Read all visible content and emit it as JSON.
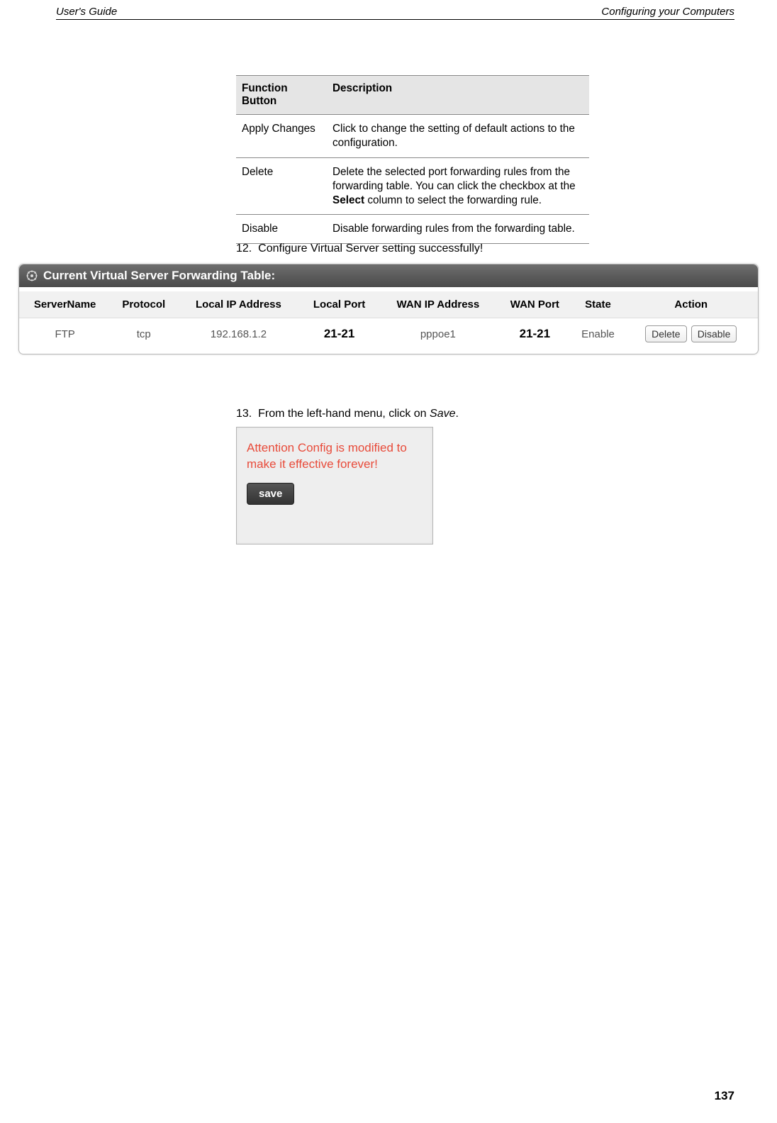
{
  "header": {
    "left": "User's Guide",
    "right": "Configuring your Computers"
  },
  "funcTable": {
    "headers": [
      "Function Button",
      "Description"
    ],
    "rows": [
      {
        "btn": "Apply Changes",
        "desc": "Click to change the setting of default actions to the configuration."
      },
      {
        "btn": "Delete",
        "desc_pre": "Delete the selected port forwarding rules from the forwarding table. You can click the checkbox at the ",
        "desc_bold": "Select",
        "desc_post": " column to select the forwarding rule."
      },
      {
        "btn": "Disable",
        "desc": "Disable forwarding rules from the forwarding table."
      }
    ]
  },
  "step12": {
    "num": "12.",
    "text": "Configure Virtual Server setting successfully!"
  },
  "panel1": {
    "title": "Current Virtual Server Forwarding Table:",
    "headers": [
      "ServerName",
      "Protocol",
      "Local IP Address",
      "Local Port",
      "WAN IP Address",
      "WAN Port",
      "State",
      "Action"
    ],
    "row": {
      "serverName": "FTP",
      "protocol": "tcp",
      "localIp": "192.168.1.2",
      "localPort": "21-21",
      "wanIp": "pppoe1",
      "wanPort": "21-21",
      "state": "Enable",
      "actionDelete": "Delete",
      "actionDisable": "Disable"
    }
  },
  "step13": {
    "num": "13.",
    "text_pre": "From the left-hand menu, click on ",
    "text_em": "Save",
    "text_post": "."
  },
  "panel2": {
    "msg": "Attention Config is modified to make it effective forever!",
    "btn": "save"
  },
  "pageNumber": "137"
}
